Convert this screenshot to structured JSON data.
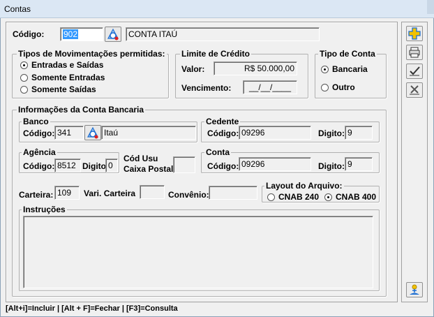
{
  "window": {
    "title": "Contas"
  },
  "codigo": {
    "label": "Código:",
    "value": "902",
    "name": "CONTA ITAÚ"
  },
  "tipos_mov": {
    "title": "Tipos de Movimentações permitidas:",
    "options": [
      "Entradas e Saídas",
      "Somente Entradas",
      "Somente Saídas"
    ],
    "selected": 0
  },
  "limite": {
    "title": "Limite de Crédito",
    "valor_label": "Valor:",
    "valor": "R$ 50.000,00",
    "vencimento_label": "Vencimento:",
    "vencimento": "__/__/____"
  },
  "tipo_conta": {
    "title": "Tipo de Conta",
    "options": [
      "Bancaria",
      "Outro"
    ],
    "selected": 0
  },
  "info": {
    "title": "Informações da Conta Bancaria",
    "banco": {
      "title": "Banco",
      "codigo_label": "Código:",
      "codigo": "341",
      "nome": "Itaú"
    },
    "cedente": {
      "title": "Cedente",
      "codigo_label": "Código:",
      "codigo": "09296",
      "digito_label": "Digito:",
      "digito": "9"
    },
    "agencia": {
      "title": "Agência",
      "codigo_label": "Código:",
      "codigo": "8512",
      "digito_label": "Digito",
      "digito": "0"
    },
    "cod_usu": {
      "label1": "Cód Usu",
      "label2": "Caixa Postal",
      "value": ""
    },
    "conta": {
      "title": "Conta",
      "codigo_label": "Código:",
      "codigo": "09296",
      "digito_label": "Digito:",
      "digito": "9"
    },
    "carteira_label": "Carteira:",
    "carteira": "109",
    "vari_label": "Vari. Carteira",
    "vari": "",
    "convenio_label": "Convênio:",
    "convenio": "",
    "layout": {
      "title": "Layout do Arquivo:",
      "options": [
        "CNAB 240",
        "CNAB 400"
      ],
      "selected": 1
    },
    "instrucoes": {
      "title": "Instruções",
      "value": ""
    }
  },
  "toolbar": {
    "icons": [
      "add-icon",
      "print-icon",
      "confirm-icon",
      "cancel-icon",
      "exit-icon"
    ]
  },
  "status": {
    "text": "[Alt+i]=Incluir  |   [Alt + F]=Fechar  |   [F3]=Consulta"
  },
  "colors": {
    "accent_blue": "#3399ff",
    "add_yellow": "#f2c200",
    "icon_blue": "#1f6fd1"
  }
}
